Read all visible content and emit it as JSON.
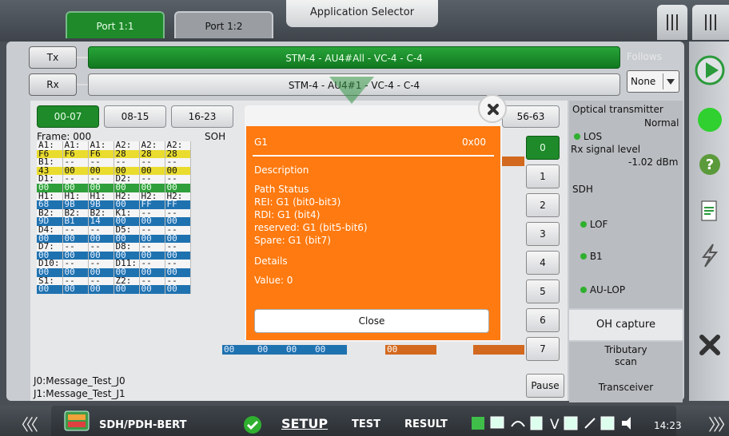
{
  "header": {
    "port_tabs": [
      "Port 1:1",
      "Port 1:2"
    ],
    "app_selector_label": "Application Selector"
  },
  "signal": {
    "tx_label": "Tx",
    "rx_label": "Rx",
    "tx_path": "STM-4 - AU4#All - VC-4 - C-4",
    "rx_path": "STM-4 - AU4#1 - VC-4 - C-4",
    "follows_label": "Follows",
    "follows_value": "None"
  },
  "ranges": [
    "00-07",
    "08-15",
    "16-23",
    "56-63"
  ],
  "overhead": {
    "frame_label": "Frame: 000",
    "soh_label": "SOH",
    "rows": [
      {
        "kind": "lbl",
        "cells": [
          "A1:",
          "A1:",
          "A1:",
          "A2:",
          "A2:",
          "A2:"
        ]
      },
      {
        "kind": "v-yellow",
        "cells": [
          "F6",
          "F6",
          "F6",
          "28",
          "28",
          "28"
        ]
      },
      {
        "kind": "lbl",
        "cells": [
          "B1:",
          "--",
          "--",
          "--",
          "--",
          "--"
        ]
      },
      {
        "kind": "v-yellow",
        "cells": [
          "43",
          "00",
          "00",
          "00",
          "00",
          "00"
        ]
      },
      {
        "kind": "lbl",
        "cells": [
          "D1:",
          "--",
          "--",
          "D2:",
          "--",
          "--"
        ]
      },
      {
        "kind": "v-green",
        "cells": [
          "00",
          "00",
          "00",
          "00",
          "00",
          "00"
        ]
      },
      {
        "kind": "lbl",
        "cells": [
          "H1:",
          "H1:",
          "H1:",
          "H2:",
          "H2:",
          "H2:"
        ]
      },
      {
        "kind": "v-blue",
        "cells": [
          "68",
          "9B",
          "9B",
          "00",
          "FF",
          "FF"
        ]
      },
      {
        "kind": "lbl",
        "cells": [
          "B2:",
          "B2:",
          "B2:",
          "K1:",
          "--",
          "--"
        ]
      },
      {
        "kind": "v-blue",
        "cells": [
          "9D",
          "B1",
          "14",
          "00",
          "00",
          "00"
        ]
      },
      {
        "kind": "lbl",
        "cells": [
          "D4:",
          "--",
          "--",
          "D5:",
          "--",
          "--"
        ]
      },
      {
        "kind": "v-blue",
        "cells": [
          "00",
          "00",
          "00",
          "00",
          "00",
          "00"
        ]
      },
      {
        "kind": "lbl",
        "cells": [
          "D7:",
          "--",
          "--",
          "D8:",
          "--",
          "--"
        ]
      },
      {
        "kind": "v-blue",
        "cells": [
          "00",
          "00",
          "00",
          "00",
          "00",
          "00"
        ]
      },
      {
        "kind": "lbl",
        "cells": [
          "D10:",
          "--",
          "--",
          "D11:",
          "--",
          "--"
        ]
      },
      {
        "kind": "v-blue",
        "cells": [
          "00",
          "00",
          "00",
          "00",
          "00",
          "00"
        ]
      },
      {
        "kind": "lbl",
        "cells": [
          "S1:",
          "--",
          "--",
          "Z2:",
          "--",
          "--"
        ]
      },
      {
        "kind": "v-blue",
        "cells": [
          "00",
          "00",
          "00",
          "00",
          "00",
          "00"
        ]
      }
    ],
    "extra_bottom": [
      "00",
      "00",
      "00",
      "00"
    ],
    "j0": "J0:Message_Test_J0",
    "j1": "J1:Message_Test_J1"
  },
  "byte_buttons": [
    "0",
    "1",
    "2",
    "3",
    "4",
    "5",
    "6",
    "7"
  ],
  "pause_label": "Pause",
  "status": {
    "optical_title": "Optical transmitter",
    "optical_value": "Normal",
    "los": "LOS",
    "rx_level_label": "Rx signal level",
    "rx_level_value": "-1.02 dBm",
    "sdh": "SDH",
    "lof": "LOF",
    "b1": "B1",
    "aulop": "AU-LOP"
  },
  "side_buttons": {
    "oh_capture": "OH capture",
    "tributary_scan_1": "Tributary",
    "tributary_scan_2": "scan",
    "transceiver": "Transceiver"
  },
  "dialog": {
    "title": "G1",
    "value": "0x00",
    "description_label": "Description",
    "lines": [
      "Path Status",
      "REI: G1 (bit0-bit3)",
      "RDI: G1 (bit4)",
      "reserved: G1 (bit5-bit6)",
      "Spare: G1 (bit7)"
    ],
    "details_label": "Details",
    "value_line": "Value: 0",
    "close_label": "Close"
  },
  "bottom": {
    "app_name": "SDH/PDH-BERT",
    "tabs": {
      "setup": "SETUP",
      "test": "TEST",
      "result": "RESULT"
    },
    "clock": "14:23"
  },
  "colors": {
    "accent_green": "#1e8a2a",
    "dialog_orange": "#ff7a10",
    "led_green": "#2fb02f"
  }
}
